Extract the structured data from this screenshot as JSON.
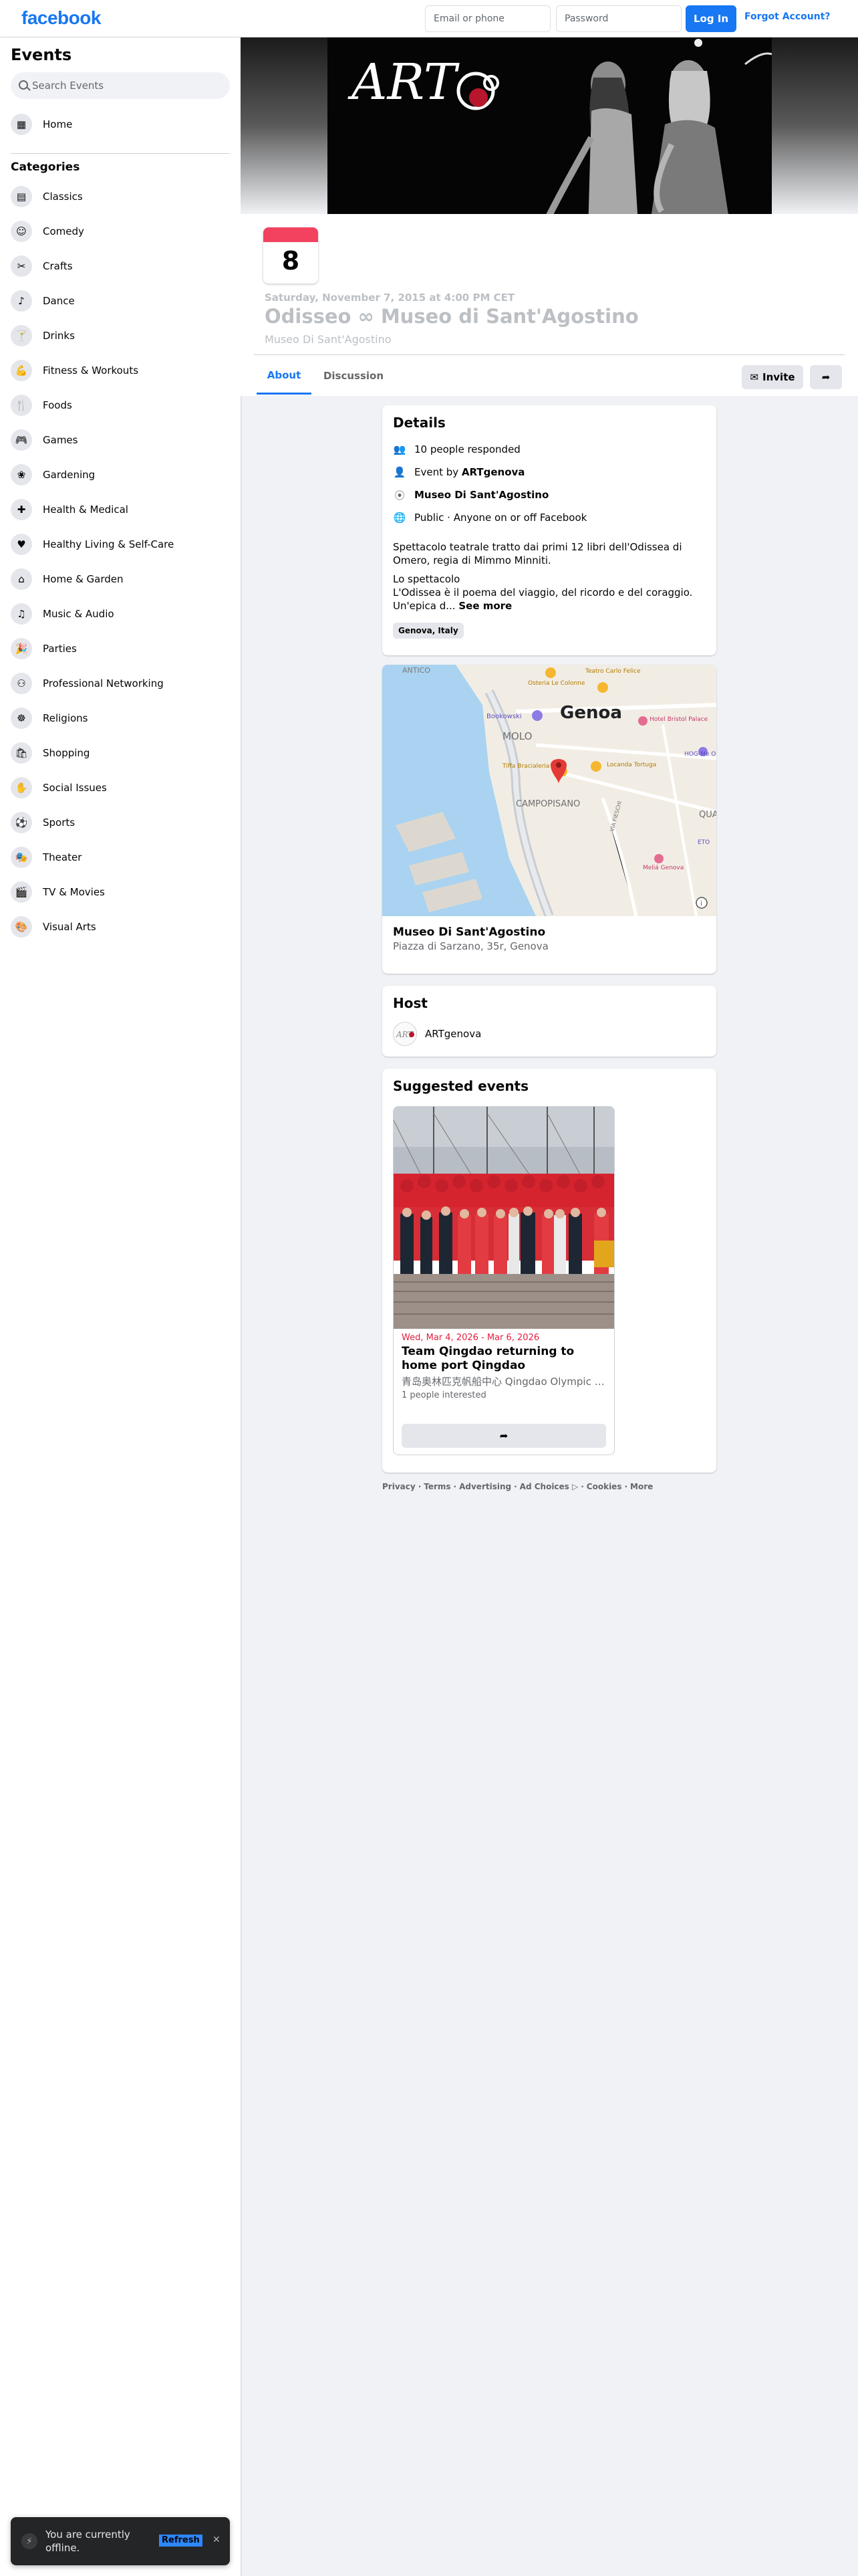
{
  "header": {
    "logo": "facebook",
    "email_placeholder": "Email or phone",
    "password_placeholder": "Password",
    "login_label": "Log In",
    "forgot_label": "Forgot Account?"
  },
  "sidebar": {
    "title": "Events",
    "search_placeholder": "Search Events",
    "home_label": "Home",
    "categories_heading": "Categories",
    "categories": [
      {
        "label": "Classics",
        "icon": "classics-icon"
      },
      {
        "label": "Comedy",
        "icon": "comedy-icon"
      },
      {
        "label": "Crafts",
        "icon": "crafts-icon"
      },
      {
        "label": "Dance",
        "icon": "dance-icon"
      },
      {
        "label": "Drinks",
        "icon": "drinks-icon"
      },
      {
        "label": "Fitness & Workouts",
        "icon": "fitness-icon"
      },
      {
        "label": "Foods",
        "icon": "foods-icon"
      },
      {
        "label": "Games",
        "icon": "games-icon"
      },
      {
        "label": "Gardening",
        "icon": "gardening-icon"
      },
      {
        "label": "Health & Medical",
        "icon": "health-icon"
      },
      {
        "label": "Healthy Living & Self-Care",
        "icon": "healthy-living-icon"
      },
      {
        "label": "Home & Garden",
        "icon": "home-garden-icon"
      },
      {
        "label": "Music & Audio",
        "icon": "music-icon"
      },
      {
        "label": "Parties",
        "icon": "parties-icon"
      },
      {
        "label": "Professional Networking",
        "icon": "networking-icon"
      },
      {
        "label": "Religions",
        "icon": "religions-icon"
      },
      {
        "label": "Shopping",
        "icon": "shopping-icon"
      },
      {
        "label": "Social Issues",
        "icon": "social-issues-icon"
      },
      {
        "label": "Sports",
        "icon": "sports-icon"
      },
      {
        "label": "Theater",
        "icon": "theater-icon"
      },
      {
        "label": "TV & Movies",
        "icon": "tv-movies-icon"
      },
      {
        "label": "Visual Arts",
        "icon": "visual-arts-icon"
      }
    ]
  },
  "event": {
    "cover_text": "ART",
    "day": "8",
    "date_line": "Saturday, November 7, 2015 at 4:00 PM CET",
    "title": "Odisseo ∞ Museo di Sant'Agostino",
    "place": "Museo Di Sant'Agostino",
    "tabs": [
      "About",
      "Discussion"
    ],
    "invite_label": "Invite"
  },
  "details": {
    "heading": "Details",
    "responded": "10 people responded",
    "event_by_prefix": "Event by ",
    "event_by_name": "ARTgenova",
    "location": "Museo Di Sant'Agostino",
    "privacy": "Public · Anyone on or off Facebook",
    "desc_1": "Spettacolo teatrale tratto dai primi 12 libri dell'Odissea di Omero, regia di Mimmo Minniti.",
    "desc_2": "Lo spettacolo",
    "desc_3": "L'Odissea è il poema del viaggio, del ricordo e del coraggio.",
    "desc_4": "Un'epica d...",
    "see_more": "See more",
    "tag": "Genova, Italy"
  },
  "map": {
    "labels": {
      "antico": "ANTICO",
      "osteria": "Osteria Le Colonne",
      "teatro": "Teatro Carlo Felice",
      "bookowski": "Bookowski",
      "genoa": "Genoa",
      "hotel": "Hotel Bristol Palace",
      "molo": "MOLO",
      "hog": "HOG-Me Orie",
      "tiffa": "Tiffa Bracialeria Piel",
      "locanda": "Locanda Tortuga",
      "campopisano": "CAMPOPISANO",
      "via": "VIA FIESCHI",
      "qua": "QUA",
      "melia": "Meliá Genova",
      "eto": "ETO"
    },
    "venue_name": "Museo Di Sant'Agostino",
    "venue_address": "Piazza di Sarzano, 35r, Genova"
  },
  "host": {
    "heading": "Host",
    "name": "ARTgenova"
  },
  "suggested": {
    "heading": "Suggested events",
    "date": "Wed, Mar 4, 2026 - Mar 6, 2026",
    "title": "Team Qingdao returning to home port Qingdao",
    "location": "青岛奥林匹克帆船中心 Qingdao Olympic Sailing Center",
    "interested": "1 people interested"
  },
  "footer": [
    "Privacy",
    "·",
    "Terms",
    "·",
    "Advertising",
    "·",
    "Ad Choices ▷",
    "·",
    "Cookies",
    "·",
    "More"
  ],
  "toast": {
    "message": "You are currently offline.",
    "action": "Refresh"
  },
  "colors": {
    "brand": "#1877f2",
    "calendar_red": "#f3425f",
    "date_red": "#e41e3f",
    "toast_bg": "#242526"
  }
}
